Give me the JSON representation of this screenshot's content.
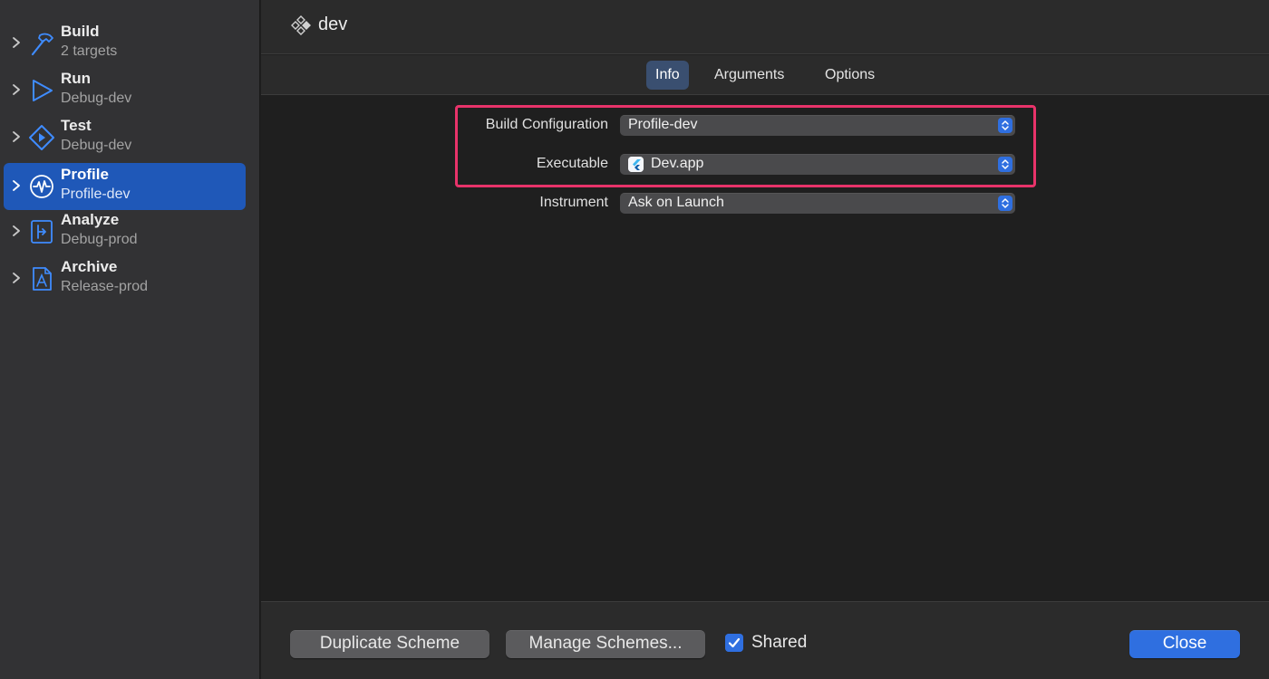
{
  "sidebar": {
    "items": [
      {
        "title": "Build",
        "subtitle": "2 targets",
        "icon": "hammer-icon",
        "selected": false
      },
      {
        "title": "Run",
        "subtitle": "Debug-dev",
        "icon": "play-icon",
        "selected": false
      },
      {
        "title": "Test",
        "subtitle": "Debug-dev",
        "icon": "test-diamond-icon",
        "selected": false
      },
      {
        "title": "Profile",
        "subtitle": "Profile-dev",
        "icon": "waveform-gauge-icon",
        "selected": true
      },
      {
        "title": "Analyze",
        "subtitle": "Debug-prod",
        "icon": "analyze-icon",
        "selected": false
      },
      {
        "title": "Archive",
        "subtitle": "Release-prod",
        "icon": "archive-app-icon",
        "selected": false
      }
    ]
  },
  "header": {
    "scheme_name": "dev",
    "scheme_icon": "scheme-diamonds-icon"
  },
  "tabs": [
    {
      "label": "Info",
      "active": true
    },
    {
      "label": "Arguments",
      "active": false
    },
    {
      "label": "Options",
      "active": false
    }
  ],
  "form": {
    "build_configuration": {
      "label": "Build Configuration",
      "value": "Profile-dev"
    },
    "executable": {
      "label": "Executable",
      "value": "Dev.app",
      "icon": "flutter-app-icon"
    },
    "instrument": {
      "label": "Instrument",
      "value": "Ask on Launch"
    }
  },
  "footer": {
    "duplicate_label": "Duplicate Scheme",
    "manage_label": "Manage Schemes...",
    "shared_label": "Shared",
    "shared_checked": true,
    "close_label": "Close"
  },
  "colors": {
    "accent": "#2f6fe0",
    "selection": "#1f58b8",
    "highlight_border": "#e8336a"
  }
}
